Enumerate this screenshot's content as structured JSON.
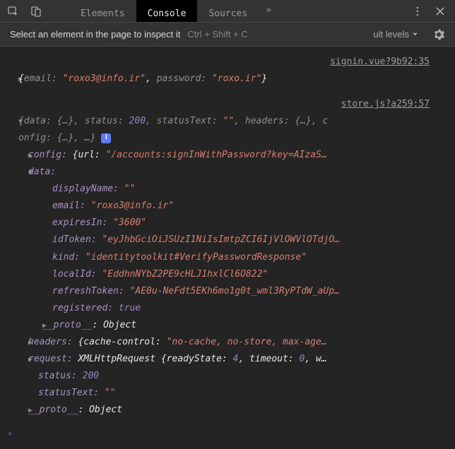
{
  "tabs": {
    "elements": "Elements",
    "console": "Console",
    "sources": "Sources",
    "more": "»"
  },
  "tooltip": {
    "text": "Select an element in the page to inspect it",
    "shortcut": "Ctrl + Shift + C",
    "levels": "ult levels"
  },
  "sourceLinks": {
    "signin": "signin.vue?9b92:35",
    "store": "store.js?a259:57"
  },
  "log1": {
    "open": "{",
    "emailKey": "email:",
    "emailVal": "\"roxo3@info.ir\"",
    "sep": ",",
    "passKey": "password:",
    "passVal": "\"roxo.ir\"",
    "close": "}"
  },
  "log2": {
    "line1a": "{data: {…}, status: ",
    "line1b": "200",
    "line1c": ", statusText: ",
    "line1d": "\"\"",
    "line1e": ", headers: {…}, c",
    "line2a": "onfig: {…}, …}",
    "config_k": "config:",
    "config_v1": " {url: ",
    "config_v2": "\"/accounts:signInWithPassword?key=AIzaS…",
    "data_k": "data:",
    "displayName_k": "displayName:",
    "displayName_v": "\"\"",
    "email_k": "email:",
    "email_v": "\"roxo3@info.ir\"",
    "expiresIn_k": "expiresIn:",
    "expiresIn_v": "\"3600\"",
    "idToken_k": "idToken:",
    "idToken_v": "\"eyJhbGciOiJSUzI1NiIsImtpZCI6IjVlOWVlOTdjO…",
    "kind_k": "kind:",
    "kind_v": "\"identitytoolkit#VerifyPasswordResponse\"",
    "localId_k": "localId:",
    "localId_v": "\"EddhnNYbZ2PE9cHLJ1hxlCl6O822\"",
    "refreshToken_k": "refreshToken:",
    "refreshToken_v": "\"AE0u-NeFdt5EKh6mo1g0t_wml3RyPTdW_aUp…",
    "registered_k": "registered:",
    "registered_v": "true",
    "proto_k": "__proto__",
    "proto_v": ": Object",
    "headers_k": "headers:",
    "headers_v1": " {cache-control: ",
    "headers_v2": "\"no-cache, no-store, max-age…",
    "request_k": "request:",
    "request_v1": " XMLHttpRequest {readyState: ",
    "request_v2": "4",
    "request_v3": ", timeout: ",
    "request_v4": "0",
    "request_v5": ", w…",
    "status_k": "status:",
    "status_v": "200",
    "statusText_k": "statusText:",
    "statusText_v": "\"\""
  },
  "infoBadge": "i",
  "promptChar": "›"
}
